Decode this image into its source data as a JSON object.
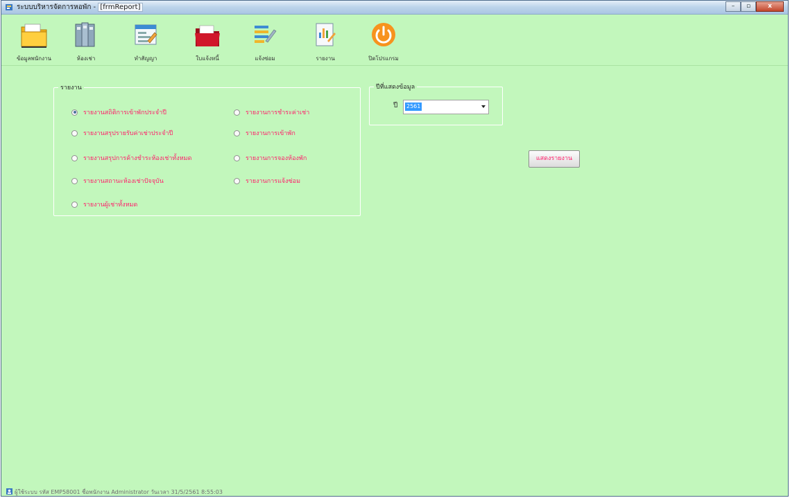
{
  "window": {
    "title_prefix": "ระบบบริหารจัดการหอพัก - ",
    "title_form": "[frmReport]",
    "minimize": "–",
    "restore": "▫",
    "close": "x"
  },
  "toolbar": {
    "items": [
      {
        "label": "ข้อมูลพนักงาน",
        "icon": "folder-icon"
      },
      {
        "label": "ห้องเช่า",
        "icon": "binders-icon"
      },
      {
        "label": "ทำสัญญา",
        "icon": "contract-icon"
      },
      {
        "label": "ใบแจ้งหนี้",
        "icon": "red-folder-icon"
      },
      {
        "label": "แจ้งซ่อม",
        "icon": "pen-document-icon"
      },
      {
        "label": "รายงาน",
        "icon": "report-icon"
      },
      {
        "label": "ปิดโปรแกรม",
        "icon": "power-icon"
      }
    ]
  },
  "report_group": {
    "title": "รายงาน",
    "options": [
      {
        "label": "รายงานสถิติการเข้าพักประจำปี",
        "selected": true
      },
      {
        "label": "รายงานสรุปรายรับค่าเช่าประจำปี",
        "selected": false
      },
      {
        "label": "รายงานสรุปการค้างชำระห้องเช่าทั้งหมด",
        "selected": false
      },
      {
        "label": "รายงานสถานะห้องเช่าปัจจุบัน",
        "selected": false
      },
      {
        "label": "รายงานผู้เช่าทั้งหมด",
        "selected": false
      },
      {
        "label": "รายงานการชำระค่าเช่า",
        "selected": false
      },
      {
        "label": "รายงานการเข้าพัก",
        "selected": false
      },
      {
        "label": "รายงานการจองห้องพัก",
        "selected": false
      },
      {
        "label": "รายงานการแจ้งซ่อม",
        "selected": false
      }
    ]
  },
  "year_group": {
    "title": "ปีที่แสดงข้อมูล",
    "year_label": "ปี",
    "year_value": "2561"
  },
  "show_report_button": "แสดงรายงาน",
  "status": {
    "text": "ผู้ใช้ระบบ รหัส  EMP58001  ชื่อพนักงาน  Administrator  วันเวลา  31/5/2561 8:55:03"
  },
  "colors": {
    "background": "#c2f7bc",
    "option_text": "#ff1f6b",
    "selection": "#3399ff"
  }
}
